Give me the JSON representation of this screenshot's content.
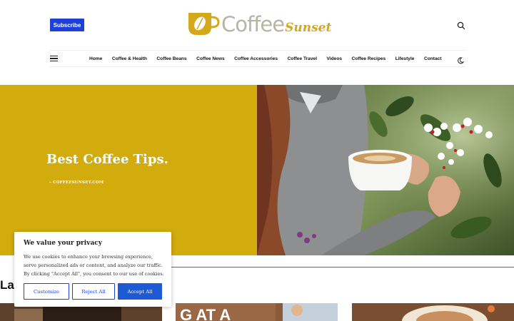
{
  "header": {
    "subscribe_label": "Subscribe",
    "logo_main": "Coffee",
    "logo_script": "Sunset"
  },
  "nav": {
    "items": [
      "Home",
      "Coffee & Health",
      "Coffee Beans",
      "Coffee News",
      "Coffee Accessories",
      "Coffee Travel",
      "Videos",
      "Coffee Recipes",
      "Lifestyle",
      "Contact"
    ]
  },
  "hero": {
    "title": "Best Coffee Tips.",
    "subtitle": "– COFFEESUNSET.COM"
  },
  "latest": {
    "heading": "Latest"
  },
  "cookie": {
    "title": "We value your privacy",
    "body": "We use cookies to enhance your browsing experience, serve personalized ads or content, and analyze our traffic. By clicking \"Accept All\", you consent to our use of cookies.",
    "customize_label": "Customize",
    "reject_label": "Reject All",
    "accept_label": "Accept All"
  },
  "colors": {
    "accent_blue": "#1e40d6",
    "hero_yellow": "#d2ab0c",
    "logo_gold": "#d3a81a",
    "logo_grey": "#b9b2a6"
  },
  "icons": {
    "search": "search-icon",
    "menu": "hamburger-menu-icon",
    "dark_mode": "moon-icon"
  }
}
